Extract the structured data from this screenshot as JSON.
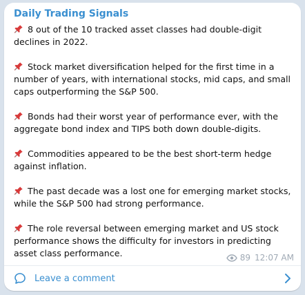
{
  "channel": {
    "name": "Daily Trading Signals"
  },
  "post": {
    "items": [
      {
        "icon": "pushpin-icon",
        "text": "8 out of the 10 tracked asset classes had double-digit declines in 2022."
      },
      {
        "icon": "pushpin-icon",
        "text": "Stock market diversification helped for the first time in a number of years, with international stocks, mid caps, and small caps outperforming the S&P 500."
      },
      {
        "icon": "pushpin-icon",
        "text": "Bonds had their worst year of performance ever, with the aggregate bond index and TIPS both down double-digits."
      },
      {
        "icon": "pushpin-icon",
        "text": "Commodities appeared to be the best short-term hedge against inflation."
      },
      {
        "icon": "pushpin-icon",
        "text": "The past decade was a lost one for emerging market stocks, while the S&P 500 had strong performance."
      },
      {
        "icon": "pushpin-icon",
        "text": "The role reversal between emerging market and US stock performance shows the difficulty for investors in predicting asset class performance."
      }
    ],
    "views": "89",
    "time": "12:07 AM"
  },
  "comment": {
    "label": "Leave a comment",
    "icon": "comment-bubble-icon"
  },
  "colors": {
    "accent": "#3a8fd0",
    "meta": "#a0aab5",
    "pin": "#d83a3a"
  }
}
